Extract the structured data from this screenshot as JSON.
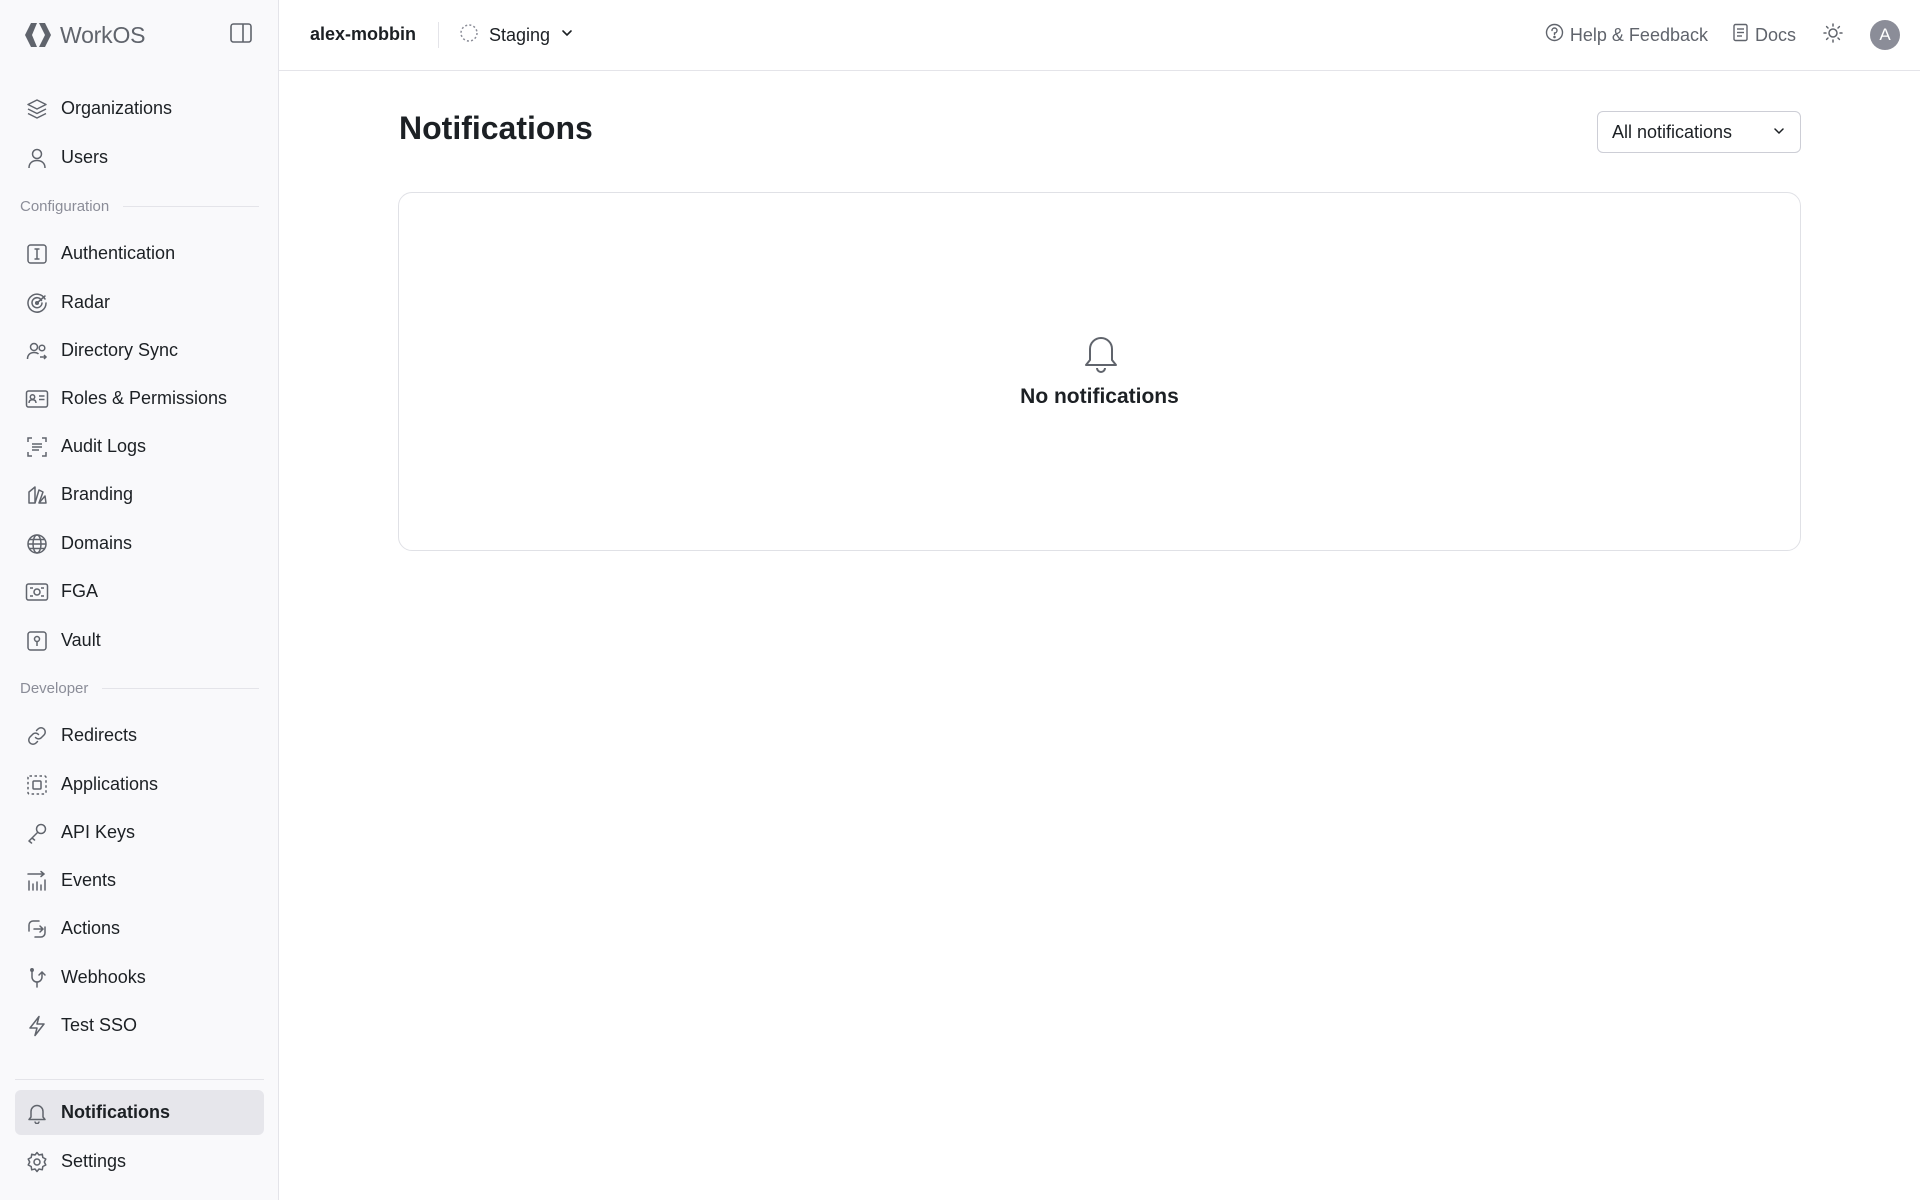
{
  "brand": {
    "name": "WorkOS"
  },
  "sidebar": {
    "top_items": [
      {
        "label": "Organizations",
        "icon": "layers-icon"
      },
      {
        "label": "Users",
        "icon": "user-icon"
      }
    ],
    "configuration": {
      "title": "Configuration",
      "items": [
        {
          "label": "Authentication",
          "icon": "authentication-icon"
        },
        {
          "label": "Radar",
          "icon": "radar-icon"
        },
        {
          "label": "Directory Sync",
          "icon": "directory-sync-icon"
        },
        {
          "label": "Roles & Permissions",
          "icon": "roles-icon"
        },
        {
          "label": "Audit Logs",
          "icon": "audit-logs-icon"
        },
        {
          "label": "Branding",
          "icon": "branding-icon"
        },
        {
          "label": "Domains",
          "icon": "globe-icon"
        },
        {
          "label": "FGA",
          "icon": "fga-icon"
        },
        {
          "label": "Vault",
          "icon": "vault-icon"
        }
      ]
    },
    "developer": {
      "title": "Developer",
      "items": [
        {
          "label": "Redirects",
          "icon": "link-icon"
        },
        {
          "label": "Applications",
          "icon": "applications-icon"
        },
        {
          "label": "API Keys",
          "icon": "key-icon"
        },
        {
          "label": "Events",
          "icon": "events-icon"
        },
        {
          "label": "Actions",
          "icon": "actions-icon"
        },
        {
          "label": "Webhooks",
          "icon": "webhook-icon"
        },
        {
          "label": "Test SSO",
          "icon": "lightning-icon"
        }
      ]
    },
    "bottom_items": [
      {
        "label": "Notifications",
        "icon": "bell-icon",
        "active": true
      },
      {
        "label": "Settings",
        "icon": "gear-icon"
      }
    ]
  },
  "topbar": {
    "org_name": "alex-mobbin",
    "environment": "Staging",
    "help_label": "Help & Feedback",
    "docs_label": "Docs",
    "avatar_initial": "A"
  },
  "main": {
    "title": "Notifications",
    "filter": {
      "selected": "All notifications"
    },
    "empty_state": {
      "message": "No notifications"
    }
  },
  "colors": {
    "sidebar_bg": "#f9f9fb",
    "active_item_bg": "#e6e6eb",
    "text_primary": "#1c2024",
    "text_muted": "#60646c"
  }
}
